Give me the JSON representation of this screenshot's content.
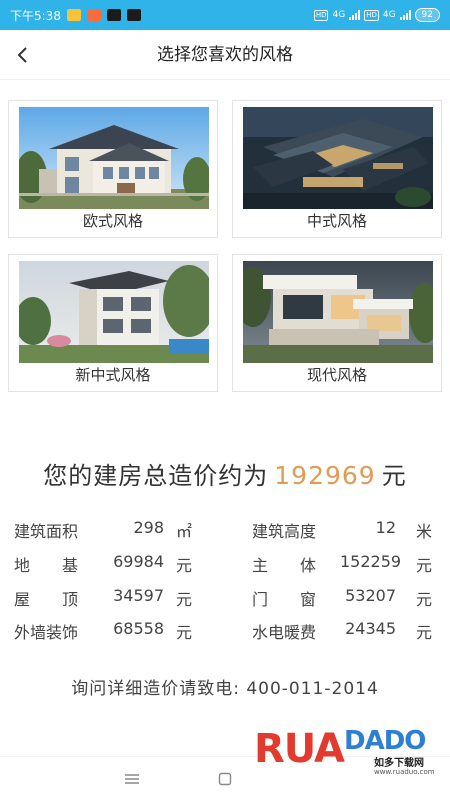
{
  "status_bar": {
    "time": "下午5:38",
    "battery": "92",
    "net1": "4G",
    "net2": "4G",
    "hd": "HD"
  },
  "header": {
    "title": "选择您喜欢的风格"
  },
  "styles": [
    {
      "label": "欧式风格"
    },
    {
      "label": "中式风格"
    },
    {
      "label": "新中式风格"
    },
    {
      "label": "现代风格"
    }
  ],
  "summary": {
    "prefix": "您的建房总造价约为",
    "amount": "192969",
    "unit": "元"
  },
  "details": [
    [
      {
        "label": "建筑面积",
        "value": "298",
        "unit": "㎡"
      },
      {
        "label": "建筑高度",
        "value": "12",
        "unit": "米"
      }
    ],
    [
      {
        "label": "地　　基",
        "value": "69984",
        "unit": "元"
      },
      {
        "label": "主　　体",
        "value": "152259",
        "unit": "元"
      }
    ],
    [
      {
        "label": "屋　　顶",
        "value": "34597",
        "unit": "元"
      },
      {
        "label": "门　　窗",
        "value": "53207",
        "unit": "元"
      }
    ],
    [
      {
        "label": "外墙装饰",
        "value": "68558",
        "unit": "元"
      },
      {
        "label": "水电暖费",
        "value": "24345",
        "unit": "元"
      }
    ]
  ],
  "contact": {
    "prefix": "询问详细造价请致电:",
    "phone": "400-011-2014"
  },
  "watermark": {
    "brand_a": "RUA",
    "brand_b": "DADO",
    "cn": "如多下载网",
    "url": "www.ruaduo.com"
  },
  "colors": {
    "status_bar": "#2fb3e8",
    "accent": "#e39a55"
  }
}
